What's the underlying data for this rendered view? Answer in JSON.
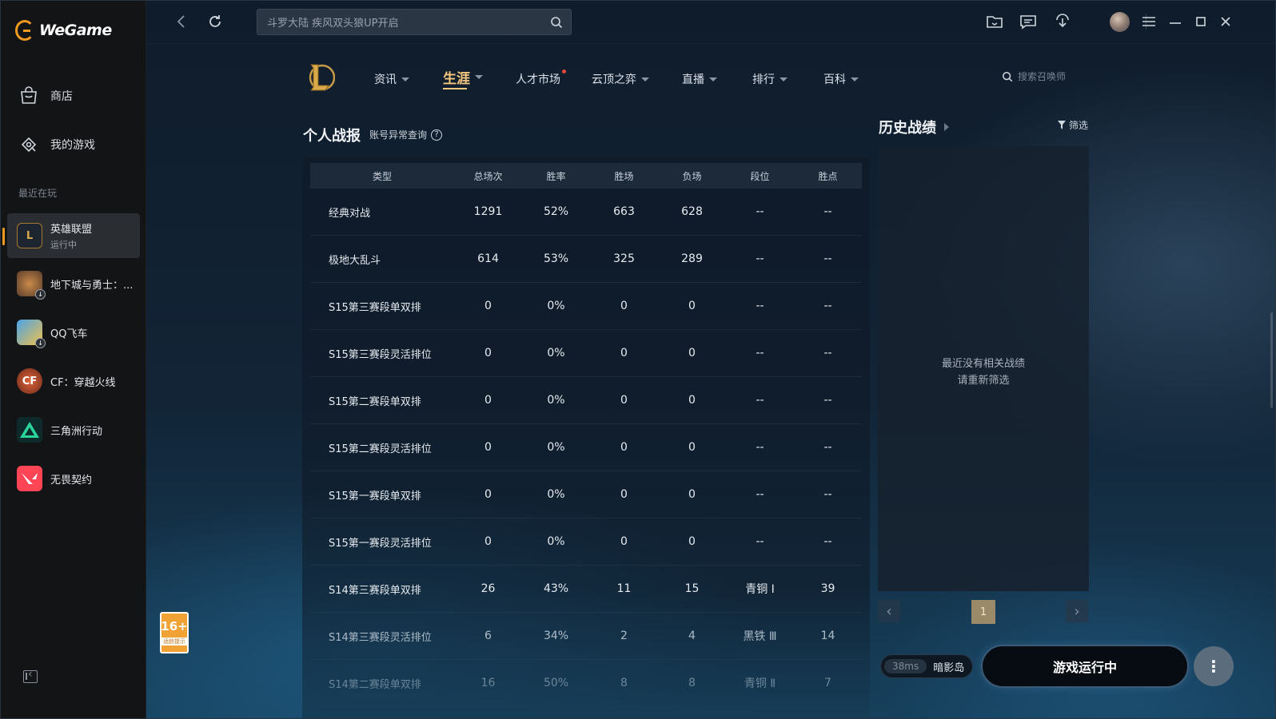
{
  "brand": {
    "name": "WeGame"
  },
  "sidebar": {
    "nav": [
      {
        "label": "商店",
        "icon": "shop-bag-icon"
      },
      {
        "label": "我的游戏",
        "icon": "my-games-icon"
      }
    ],
    "recent_label": "最近在玩",
    "games": [
      {
        "name": "英雄联盟",
        "status": "运行中",
        "icon": "lol-game-icon"
      },
      {
        "name": "地下城与勇士：...",
        "status": "",
        "icon": "dnf-game-icon"
      },
      {
        "name": "QQ飞车",
        "status": "",
        "icon": "qq-speed-game-icon"
      },
      {
        "name": "CF：穿越火线",
        "status": "",
        "icon": "crossfire-game-icon"
      },
      {
        "name": "三角洲行动",
        "status": "",
        "icon": "delta-force-game-icon"
      },
      {
        "name": "无畏契约",
        "status": "",
        "icon": "valorant-game-icon"
      }
    ],
    "age_badge": {
      "rating": "16+",
      "note": "适龄提示"
    }
  },
  "topbar": {
    "search_placeholder": "斗罗大陆  疾风双头狼UP开启"
  },
  "lol_nav": {
    "items": [
      {
        "label": "资讯",
        "caret": true
      },
      {
        "label": "生涯",
        "caret": true,
        "active": true
      },
      {
        "label": "人才市场",
        "caret": false,
        "dot": true
      },
      {
        "label": "云顶之弈",
        "caret": true
      },
      {
        "label": "直播",
        "caret": true
      },
      {
        "label": "排行",
        "caret": true
      },
      {
        "label": "百科",
        "caret": true
      }
    ],
    "search_placeholder": "搜索召唤师"
  },
  "stats": {
    "title": "个人战报",
    "link": "账号异常查询",
    "headers": [
      "类型",
      "总场次",
      "胜率",
      "胜场",
      "负场",
      "段位",
      "胜点"
    ],
    "rows": [
      [
        "经典对战",
        "1291",
        "52%",
        "663",
        "628",
        "--",
        "--"
      ],
      [
        "极地大乱斗",
        "614",
        "53%",
        "325",
        "289",
        "--",
        "--"
      ],
      [
        "S15第三赛段单双排",
        "0",
        "0%",
        "0",
        "0",
        "--",
        "--"
      ],
      [
        "S15第三赛段灵活排位",
        "0",
        "0%",
        "0",
        "0",
        "--",
        "--"
      ],
      [
        "S15第二赛段单双排",
        "0",
        "0%",
        "0",
        "0",
        "--",
        "--"
      ],
      [
        "S15第二赛段灵活排位",
        "0",
        "0%",
        "0",
        "0",
        "--",
        "--"
      ],
      [
        "S15第一赛段单双排",
        "0",
        "0%",
        "0",
        "0",
        "--",
        "--"
      ],
      [
        "S15第一赛段灵活排位",
        "0",
        "0%",
        "0",
        "0",
        "--",
        "--"
      ],
      [
        "S14第三赛段单双排",
        "26",
        "43%",
        "11",
        "15",
        "青铜 Ⅰ",
        "39"
      ],
      [
        "S14第三赛段灵活排位",
        "6",
        "34%",
        "2",
        "4",
        "黑铁 Ⅲ",
        "14"
      ],
      [
        "S14第二赛段单双排",
        "16",
        "50%",
        "8",
        "8",
        "青铜 Ⅱ",
        "7"
      ]
    ]
  },
  "history": {
    "title": "历史战绩",
    "filter": "筛选",
    "empty_line1": "最近没有相关战绩",
    "empty_line2": "请重新筛选",
    "page": "1"
  },
  "launch": {
    "ping": "38ms",
    "server": "暗影岛",
    "button": "游戏运行中"
  },
  "colors": {
    "accent": "#f29a1f",
    "active_tab": "#f5c67e"
  }
}
